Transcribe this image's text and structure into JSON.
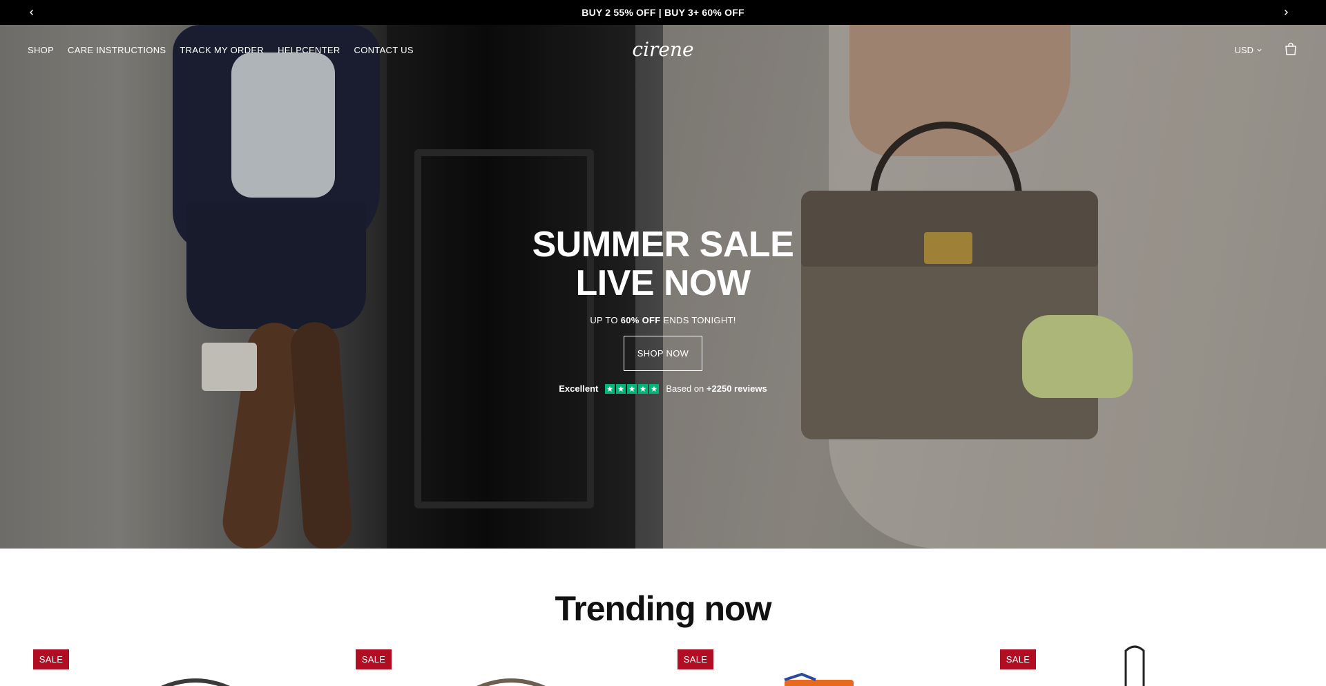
{
  "announcement": {
    "text": "BUY 2 55% OFF | BUY 3+ 60% OFF",
    "prev_icon": "chevron-left-icon",
    "next_icon": "chevron-right-icon"
  },
  "nav": {
    "links": [
      "SHOP",
      "CARE INSTRUCTIONS",
      "TRACK MY ORDER",
      "HELPCENTER",
      "CONTACT US"
    ],
    "logo": "cirene",
    "currency": "USD",
    "cart_icon": "shopping-bag-icon"
  },
  "hero": {
    "title_line1": "SUMMER SALE",
    "title_line2": "LIVE NOW",
    "subtitle_prefix": "UP TO ",
    "subtitle_bold": "60% OFF",
    "subtitle_suffix": " ENDS TONIGHT!",
    "cta": "SHOP NOW",
    "rating_label": "Excellent",
    "stars": 5,
    "based_on": "Based on",
    "review_count": "+2250 reviews",
    "star_color": "#00b67a"
  },
  "trending": {
    "title": "Trending now",
    "products": [
      {
        "badge": "SALE"
      },
      {
        "badge": "SALE"
      },
      {
        "badge": "SALE"
      },
      {
        "badge": "SALE"
      }
    ],
    "badge_color": "#b10e24"
  }
}
